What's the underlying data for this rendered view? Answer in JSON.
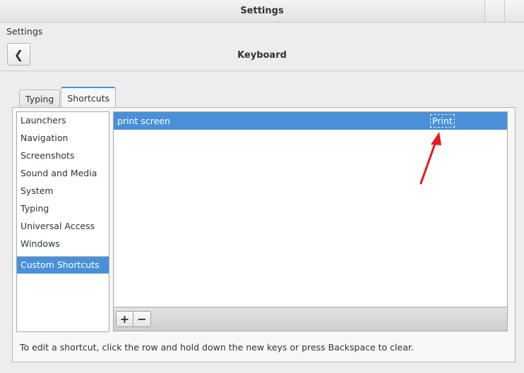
{
  "window": {
    "title": "Settings"
  },
  "header": {
    "app_label": "Settings",
    "back_glyph": "❮",
    "panel_title": "Keyboard"
  },
  "tabs": [
    {
      "label": "Typing",
      "active": false
    },
    {
      "label": "Shortcuts",
      "active": true
    }
  ],
  "categories": [
    "Launchers",
    "Navigation",
    "Screenshots",
    "Sound and Media",
    "System",
    "Typing",
    "Universal Access",
    "Windows"
  ],
  "custom_category": "Custom Shortcuts",
  "shortcuts": [
    {
      "name": "print screen",
      "key": "Print"
    }
  ],
  "toolbar": {
    "add_glyph": "+",
    "remove_glyph": "−"
  },
  "hint": "To edit a shortcut, click the row and hold down the new keys or press Backspace to clear.",
  "colors": {
    "selection": "#4a90d9",
    "annotation": "#e8181d"
  }
}
